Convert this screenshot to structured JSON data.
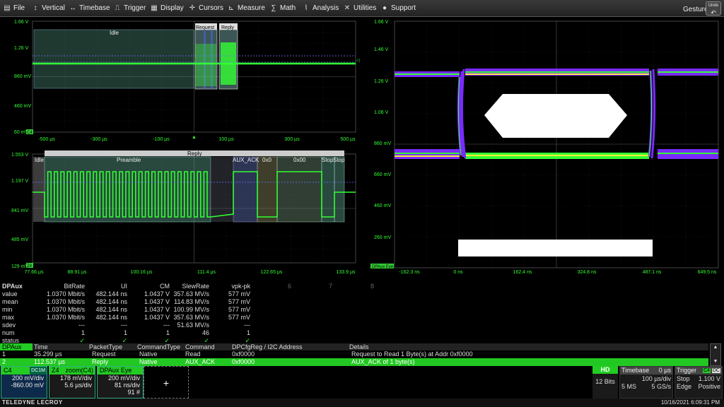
{
  "menu": {
    "items": [
      {
        "label": "File",
        "icon": "file-icon"
      },
      {
        "label": "Vertical",
        "icon": "vertical-icon"
      },
      {
        "label": "Timebase",
        "icon": "timebase-icon"
      },
      {
        "label": "Trigger",
        "icon": "trigger-icon"
      },
      {
        "label": "Display",
        "icon": "display-icon"
      },
      {
        "label": "Cursors",
        "icon": "cursors-icon"
      },
      {
        "label": "Measure",
        "icon": "measure-icon"
      },
      {
        "label": "Math",
        "icon": "math-icon"
      },
      {
        "label": "Analysis",
        "icon": "analysis-icon"
      },
      {
        "label": "Utilities",
        "icon": "utilities-icon"
      },
      {
        "label": "Support",
        "icon": "support-icon"
      }
    ],
    "gesture_label": "Gesture",
    "undo_label": "Undo"
  },
  "grid_top": {
    "y_labels": [
      "1.66 V",
      "1.26 V",
      "860 mV",
      "460 mV",
      "60 mV"
    ],
    "x_labels": [
      "-500 µs",
      "-300 µs",
      "-100 µs",
      "100 µs",
      "300 µs",
      "500 µs"
    ],
    "channel_tag": "C4",
    "packets": [
      "Idle",
      "Request",
      "Reply"
    ]
  },
  "grid_zoom": {
    "y_labels": [
      "1.553 V",
      "1.197 V",
      "841 mV",
      "485 mV",
      "129 mV"
    ],
    "x_labels": [
      "77.66 µs",
      "88.91 µs",
      "100.16 µs",
      "111.4 µs",
      "122.65 µs",
      "133.9 µs"
    ],
    "channel_tag": "Z4",
    "top_label": "Reply",
    "fields": [
      "Idle",
      "Preamble",
      "AUX_ACK",
      "0x0",
      "0x00",
      "Stop",
      "Stop"
    ]
  },
  "grid_eye": {
    "y_labels": [
      "1.66 V",
      "1.46 V",
      "1.26 V",
      "1.06 V",
      "860 mV",
      "660 mV",
      "460 mV",
      "260 mV"
    ],
    "x_labels": [
      "-162.3 ns",
      "0 ns",
      "162.4 ns",
      "324.8 ns",
      "487.1 ns",
      "649.5 ns"
    ],
    "channel_tag": "DPAux Eye"
  },
  "measure": {
    "title": "DPAux",
    "headers": [
      "BitRate",
      "UI",
      "CM",
      "SlewRate",
      "vpk-pk"
    ],
    "extra_cols": [
      "6",
      "7",
      "8"
    ],
    "rows": [
      {
        "label": "value",
        "cells": [
          "1.0370 Mbit/s",
          "482.144 ns",
          "1.0437 V",
          "357.63 MV/s",
          "577 mV"
        ]
      },
      {
        "label": "mean",
        "cells": [
          "1.0370 Mbit/s",
          "482.144 ns",
          "1.0437 V",
          "114.83 MV/s",
          "577 mV"
        ]
      },
      {
        "label": "min",
        "cells": [
          "1.0370 Mbit/s",
          "482.144 ns",
          "1.0437 V",
          "100.99 MV/s",
          "577 mV"
        ]
      },
      {
        "label": "max",
        "cells": [
          "1.0370 Mbit/s",
          "482.144 ns",
          "1.0437 V",
          "357.63 MV/s",
          "577 mV"
        ]
      },
      {
        "label": "sdev",
        "cells": [
          "---",
          "---",
          "---",
          "51.63 MV/s",
          "---"
        ]
      },
      {
        "label": "num",
        "cells": [
          "1",
          "1",
          "1",
          "46",
          "1"
        ]
      },
      {
        "label": "status",
        "cells": [
          "✓",
          "✓",
          "✓",
          "✓",
          "✓"
        ]
      }
    ]
  },
  "decode": {
    "headers": [
      "DPAux",
      "Time",
      "PacketType",
      "CommandType",
      "Command",
      "DPCfgReg / I2C Address",
      "Details"
    ],
    "rows": [
      {
        "cells": [
          "1",
          "35.299 µs",
          "Request",
          "Native",
          "Read",
          "0xf0000",
          "Request to Read 1 Byte(s) at Addr 0xf0000"
        ]
      },
      {
        "cells": [
          "2",
          "112.537 µs",
          "Reply",
          "Native",
          "AUX_ACK",
          "0xf0000",
          "AUX_ACK of 1 byte(s)"
        ]
      }
    ]
  },
  "channels": [
    {
      "title": "C4",
      "badge": "DC1M",
      "lines": [
        "200 mV/div",
        "-860.00 mV"
      ]
    },
    {
      "title": "Z4",
      "badge": "zoom(C4)",
      "lines": [
        "178 mV/div",
        "5.6 µs/div"
      ]
    },
    {
      "title": "DPAux Eye",
      "badge": "",
      "lines": [
        "200 mV/div",
        "81 ns/div",
        "91 #"
      ]
    }
  ],
  "add_label": "+",
  "hd": {
    "badge": "HD",
    "bits": "12 Bits"
  },
  "timebase": {
    "title": "Timebase",
    "offset": "0 µs",
    "rate_div": "100 µs/div",
    "samples": "5 MS",
    "sample_rate": "5 GS/s"
  },
  "trigger": {
    "title": "Trigger",
    "ch": "C4",
    "coupling": "DC",
    "mode": "Stop",
    "level": "1.100 V",
    "type": "Edge",
    "slope": "Positive"
  },
  "status": {
    "brand": "TELEDYNE LECROY",
    "datetime": "10/16/2021 6:09:31 PM"
  },
  "colors": {
    "trace": "#33ff33",
    "grid": "#2a2a2a",
    "accent": "#22cc22"
  }
}
